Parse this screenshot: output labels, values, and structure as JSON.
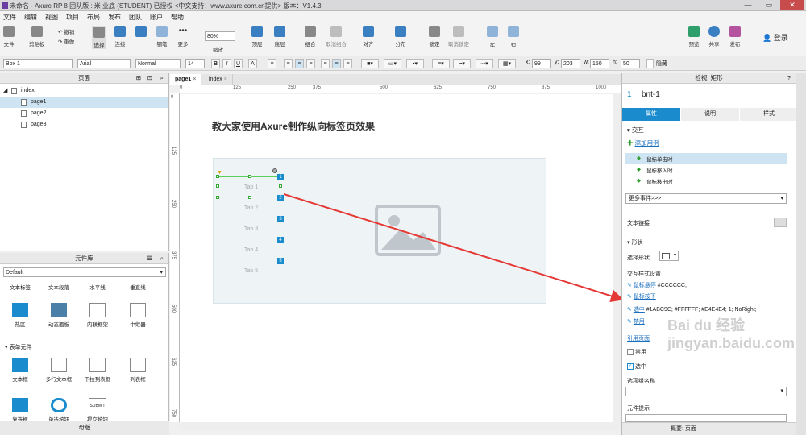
{
  "window": {
    "title": "未命名 - Axure RP 8 团队版 : 米 业底 (STUDENT) 已授权     <中文支持：www.axure.com.cn提供> 版本：V1.4.3",
    "min": "—",
    "max": "▭",
    "close": "✕"
  },
  "menu": [
    "文件",
    "编辑",
    "视图",
    "项目",
    "布局",
    "发布",
    "团队",
    "账户",
    "帮助"
  ],
  "toolbar": {
    "file": "文件",
    "clipboard": "剪贴板",
    "undo": "撤销",
    "redo": "重做",
    "select": "选择",
    "connect": "连接",
    "pen": "钢笔",
    "more": "更多",
    "zoom_value": "80%",
    "zoom_label": "缩放",
    "top": "顶层",
    "bottom": "底层",
    "group": "组合",
    "ungroup": "取消组合",
    "align": "对齐",
    "distribute": "分布",
    "lock": "锁定",
    "unlock": "取消锁定",
    "left": "左",
    "right": "右",
    "preview": "预览",
    "share": "共享",
    "publish": "发布",
    "login": "登录"
  },
  "format": {
    "widget": "Box 1",
    "font": "Arial",
    "style": "Normal",
    "size": "14",
    "x_label": "x:",
    "x": "99",
    "y_label": "y:",
    "y": "203",
    "w_label": "w:",
    "w": "150",
    "h_label": "h:",
    "h": "50",
    "hidden": "隐藏"
  },
  "pages": {
    "title": "页面",
    "items": [
      "index",
      "page1",
      "page2",
      "page3"
    ],
    "selected": "page1"
  },
  "library": {
    "title": "元件库",
    "selected": "Default",
    "row1": [
      "文本标签",
      "文本段落",
      "水平线",
      "垂直线"
    ],
    "row2": [
      "热区",
      "动态面板",
      "内联框架",
      "中继器"
    ],
    "section": "表单元件",
    "row3": [
      "文本框",
      "多行文本框",
      "下拉列表框",
      "列表框"
    ],
    "row4": [
      "复选框",
      "单选按钮",
      "提交按钮"
    ],
    "submit_text": "SUBMIT"
  },
  "masters": {
    "title": "母版"
  },
  "tabs": [
    "page1",
    "index"
  ],
  "ruler": {
    "h": [
      "0",
      "125",
      "250",
      "375",
      "500",
      "625",
      "750",
      "875",
      "1000"
    ],
    "v": [
      "0",
      "125",
      "250",
      "375",
      "500",
      "625",
      "750"
    ]
  },
  "canvas": {
    "heading": "教大家使用Axure制作纵向标签页效果",
    "tabs": [
      "Tab 1",
      "Tab 2",
      "Tab 3",
      "Tab 4",
      "Tab 5"
    ],
    "markers": [
      "1",
      "2",
      "3",
      "4",
      "5"
    ]
  },
  "inspector": {
    "header": "检视: 矩形",
    "index": "1",
    "name": "bnt-1",
    "tabs": [
      "属性",
      "说明",
      "样式"
    ],
    "interaction": "交互",
    "add_case": "添加用例",
    "events": [
      "鼠标单击时",
      "鼠标移入时",
      "鼠标移出时"
    ],
    "more_events": "更多事件>>>",
    "text_link": "文本链接",
    "shape": "形状",
    "select_shape": "选择形状",
    "interaction_styles": "交互样式设置",
    "hover_link": "鼠标悬停",
    "hover_val": "#CCCCCC;",
    "mousedown": "鼠标按下",
    "selected_link": "选中",
    "selected_val": "#1ABC9C; #FFFFFF; #E4E4E4; 1; NoRight;",
    "disabled_link": "禁用",
    "ref_page": "引用页面",
    "disabled": "禁用",
    "selected": "选中",
    "group_label": "选项组名称",
    "tooltip_label": "元件提示",
    "overview": "概要: 页面"
  },
  "watermark": "Bai du 经验 jingyan.baidu.com",
  "colors": {
    "accent": "#1a8ccd",
    "marker": "#1a8ccd",
    "arrow": "#e53935",
    "placeholder_bg": "#eef3f6"
  }
}
